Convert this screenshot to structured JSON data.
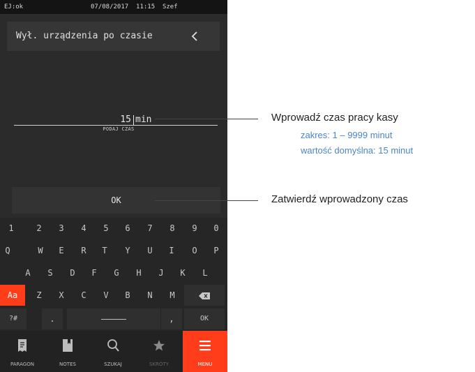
{
  "status": {
    "left": "EJ:ok",
    "center": "07/08/2017  11:15  Szef"
  },
  "header": {
    "title": "Wył. urządzenia po czasie",
    "back_icon": "chevron-left-icon"
  },
  "input": {
    "value": "15",
    "unit": "min",
    "hint": "PODAJ CZAS"
  },
  "ok_button": {
    "label": "OK"
  },
  "keyboard": {
    "row1": [
      "1",
      "2",
      "3",
      "4",
      "5",
      "6",
      "7",
      "8",
      "9",
      "0"
    ],
    "row2": [
      "Q",
      "W",
      "E",
      "R",
      "T",
      "Y",
      "U",
      "I",
      "O",
      "P"
    ],
    "row3": [
      "A",
      "S",
      "D",
      "F",
      "G",
      "H",
      "J",
      "K",
      "L"
    ],
    "row4": {
      "shift": "Aa",
      "keys": [
        "Z",
        "X",
        "C",
        "V",
        "B",
        "N",
        "M"
      ],
      "backspace_icon": "backspace-icon"
    },
    "row5": {
      "symbols": "?#",
      "dot": ".",
      "comma": ",",
      "ok": "OK"
    }
  },
  "tabs": [
    {
      "label": "PARAGON",
      "icon": "receipt-icon"
    },
    {
      "label": "NOTES",
      "icon": "notebook-icon"
    },
    {
      "label": "SZUKAJ",
      "icon": "search-icon"
    },
    {
      "label": "SKRÓTY",
      "icon": "star-icon"
    },
    {
      "label": "MENU",
      "icon": "menu-icon"
    }
  ],
  "colors": {
    "accent": "#ff3d1a",
    "annotation_blue": "#4a86c5"
  },
  "annotations": {
    "input_title": "Wprowadź czas pracy kasy",
    "range": "zakres: 1 – 9999 minut",
    "default": "wartość domyślna: 15 minut",
    "ok": "Zatwierdź wprowadzony czas"
  }
}
